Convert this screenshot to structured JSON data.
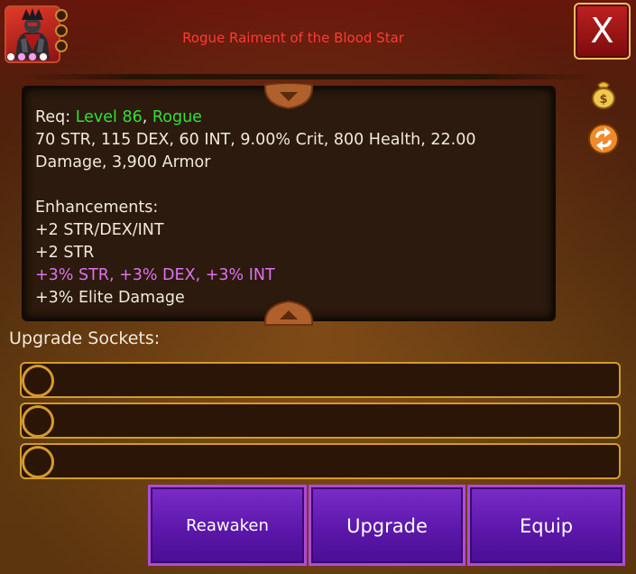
{
  "header": {
    "item_title": "Rogue Raiment of the Blood Star",
    "close_label": "X",
    "gem_slots": 3,
    "rank_dots": [
      "#ffffff",
      "#f0a0f0",
      "#f0a0f0",
      "#ffffff"
    ]
  },
  "stats": {
    "req_prefix": "Req: ",
    "req_level": "Level 86",
    "req_sep": ", ",
    "req_class": "Rogue",
    "base_stats": "70 STR, 115 DEX, 60 INT, 9.00% Crit, 800 Health, 22.00 Damage, 3,900 Armor",
    "enhancements_heading": "Enhancements:",
    "enhancements": [
      {
        "text": "+2 STR/DEX/INT",
        "color": "#f1ead8"
      },
      {
        "text": "+2 STR",
        "color": "#f1ead8"
      },
      {
        "text": "+3% STR, +3% DEX, +3% INT",
        "color": "#e070f0"
      },
      {
        "text": "+3% Elite Damage",
        "color": "#f1ead8"
      }
    ]
  },
  "sockets": {
    "label": "Upgrade Sockets:",
    "slots": [
      "",
      "",
      ""
    ]
  },
  "actions": {
    "reawaken": "Reawaken",
    "upgrade": "Upgrade",
    "equip": "Equip"
  },
  "icons": [
    "sell-bag-icon",
    "swap-icon",
    "scroll-up-icon",
    "scroll-down-icon"
  ],
  "colors": {
    "title_red": "#ff3a3a",
    "requirement_green": "#34e034",
    "enhancement_pink": "#e070f0",
    "button_purple": "#5a16a8",
    "socket_gold": "#d49a2c"
  }
}
